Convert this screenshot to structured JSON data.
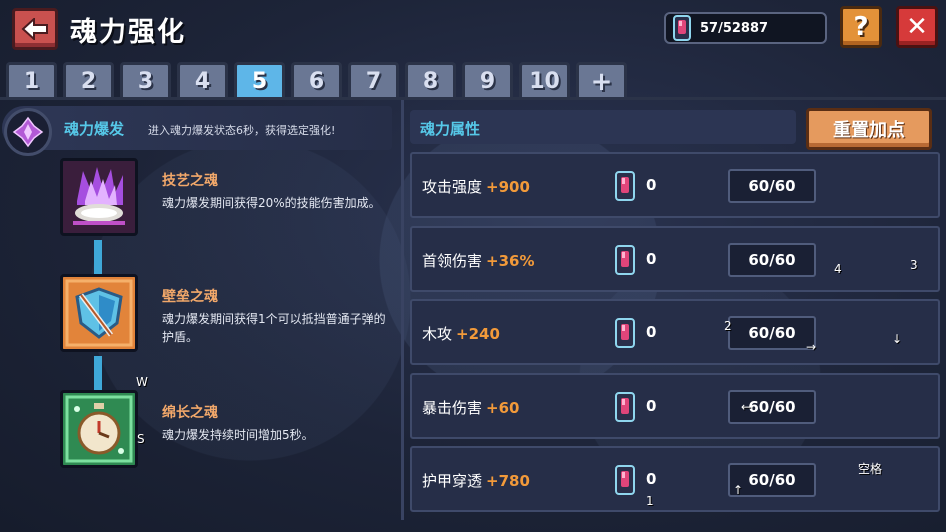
{
  "header": {
    "title": "魂力强化",
    "currency_value": "57/52887",
    "help_label": "?",
    "close_label": "✕"
  },
  "tabs": [
    {
      "label": "1",
      "active": false
    },
    {
      "label": "2",
      "active": false
    },
    {
      "label": "3",
      "active": false
    },
    {
      "label": "4",
      "active": false
    },
    {
      "label": "5",
      "active": true
    },
    {
      "label": "6",
      "active": false
    },
    {
      "label": "7",
      "active": false
    },
    {
      "label": "8",
      "active": false
    },
    {
      "label": "9",
      "active": false
    },
    {
      "label": "10",
      "active": false
    },
    {
      "label": "+",
      "active": false
    }
  ],
  "burst": {
    "name": "魂力爆发",
    "description": "进入魂力爆发状态6秒，获得选定强化!"
  },
  "souls": [
    {
      "name": "技艺之魂",
      "description": "魂力爆发期间获得20%的技能伤害加成。",
      "icon": "purple-flame-icon"
    },
    {
      "name": "壁垒之魂",
      "description": "魂力爆发期间获得1个可以抵挡普通子弹的护盾。",
      "icon": "shield-icon"
    },
    {
      "name": "绵长之魂",
      "description": "魂力爆发持续时间增加5秒。",
      "icon": "stopwatch-icon"
    }
  ],
  "attributes": {
    "title": "魂力属性",
    "reset_label": "重置加点",
    "rows": [
      {
        "name": "攻击强度",
        "bonus": "+900",
        "count": "0",
        "level": "60/60"
      },
      {
        "name": "首领伤害",
        "bonus": "+36%",
        "count": "0",
        "level": "60/60"
      },
      {
        "name": "木攻",
        "bonus": "+240",
        "count": "0",
        "level": "60/60"
      },
      {
        "name": "暴击伤害",
        "bonus": "+60",
        "count": "0",
        "level": "60/60"
      },
      {
        "name": "护甲穿透",
        "bonus": "+780",
        "count": "0",
        "level": "60/60"
      }
    ]
  },
  "key_hints": {
    "w": "W",
    "s": "S",
    "k1": "1",
    "k2": "2",
    "k3": "3",
    "k4": "4",
    "right": "→",
    "down": "↓",
    "left": "←",
    "up": "↑",
    "space": "空格"
  },
  "colors": {
    "accent_cyan": "#56c8e8",
    "bonus_orange": "#f29a3a",
    "active_tab": "#5eb6e8"
  }
}
